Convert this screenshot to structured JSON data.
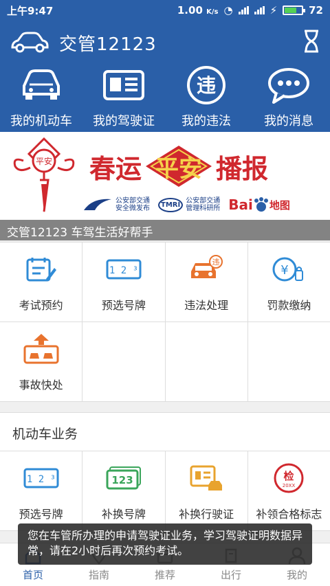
{
  "status_bar": {
    "time": "上午9:47",
    "speed": "1.00",
    "speed_unit": "K/s",
    "battery": "72",
    "battery_level": 0.72
  },
  "header": {
    "title": "交管12123",
    "nav": [
      {
        "label": "我的机动车",
        "icon": "car-icon"
      },
      {
        "label": "我的驾驶证",
        "icon": "license-card-icon"
      },
      {
        "label": "我的违法",
        "icon": "violation-icon",
        "icon_text": "违"
      },
      {
        "label": "我的消息",
        "icon": "message-icon"
      }
    ]
  },
  "banner": {
    "left_word": "春运",
    "center_word": "平安",
    "right_word": "播报",
    "knot_text": "平安",
    "sponsor1": "公安部交通\n安全微发布",
    "sponsor2_logo": "TMRI",
    "sponsor2": "公安部交通\n管理科研所",
    "sponsor3": "Bai",
    "sponsor3_b": "地图",
    "tagline": "交管12123 车驾生活好帮手"
  },
  "services": [
    {
      "label": "考试预约",
      "icon": "exam-booking-icon"
    },
    {
      "label": "预选号牌",
      "icon": "plate-select-icon",
      "icon_text": "1 2 ³"
    },
    {
      "label": "违法处理",
      "icon": "violation-handle-icon",
      "icon_text": "违"
    },
    {
      "label": "罚款缴纳",
      "icon": "fine-payment-icon",
      "icon_text": "¥"
    },
    {
      "label": "事故快处",
      "icon": "accident-icon"
    }
  ],
  "vehicle_section": {
    "title": "机动车业务",
    "items": [
      {
        "label": "预选号牌",
        "icon": "plate-select-icon",
        "icon_text": "1 2 ³"
      },
      {
        "label": "补换号牌",
        "icon": "plate-replace-icon",
        "icon_text": "123"
      },
      {
        "label": "补换行驶证",
        "icon": "driving-permit-icon"
      },
      {
        "label": "补领合格标志",
        "icon": "inspection-mark-icon",
        "icon_text": "检",
        "icon_sub": "20XX"
      }
    ]
  },
  "toast": {
    "message": "您在车管所办理的申请驾驶证业务，学习驾驶证明数据异常，请在2小时后再次预约考试。"
  },
  "tabs": [
    {
      "label": "首页",
      "active": true,
      "icon": "home-icon"
    },
    {
      "label": "指南",
      "active": false,
      "icon": "guide-icon"
    },
    {
      "label": "推荐",
      "active": false,
      "icon": "recommend-icon"
    },
    {
      "label": "出行",
      "active": false,
      "icon": "travel-icon"
    },
    {
      "label": "我的",
      "active": false,
      "icon": "profile-icon"
    }
  ],
  "colors": {
    "brand_blue": "#2a5fa8",
    "accent_red": "#d0282e",
    "icon_blue": "#2f8bd6",
    "icon_green": "#3aa55a",
    "icon_orange": "#e8732e"
  }
}
